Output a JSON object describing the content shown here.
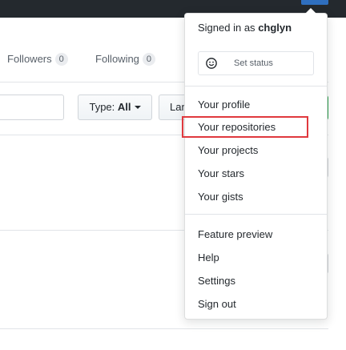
{
  "profile_tabs": {
    "followers": {
      "label": "Followers",
      "count": "0"
    },
    "following": {
      "label": "Following",
      "count": "0"
    }
  },
  "filters": {
    "type_label": "Type:",
    "type_value": "All",
    "language_label": "Language"
  },
  "user_menu": {
    "signed_in_prefix": "Signed in as",
    "username": "chglyn",
    "set_status_label": "Set status",
    "status_icon": "smiley-icon",
    "items_group1": [
      "Your profile",
      "Your repositories",
      "Your projects",
      "Your stars",
      "Your gists"
    ],
    "items_group2": [
      "Feature preview",
      "Help",
      "Settings",
      "Sign out"
    ],
    "highlighted_item": "Your repositories"
  },
  "colors": {
    "header_bg": "#24292e",
    "highlight": "#e0393e",
    "primary_button": "#2ea44f"
  }
}
